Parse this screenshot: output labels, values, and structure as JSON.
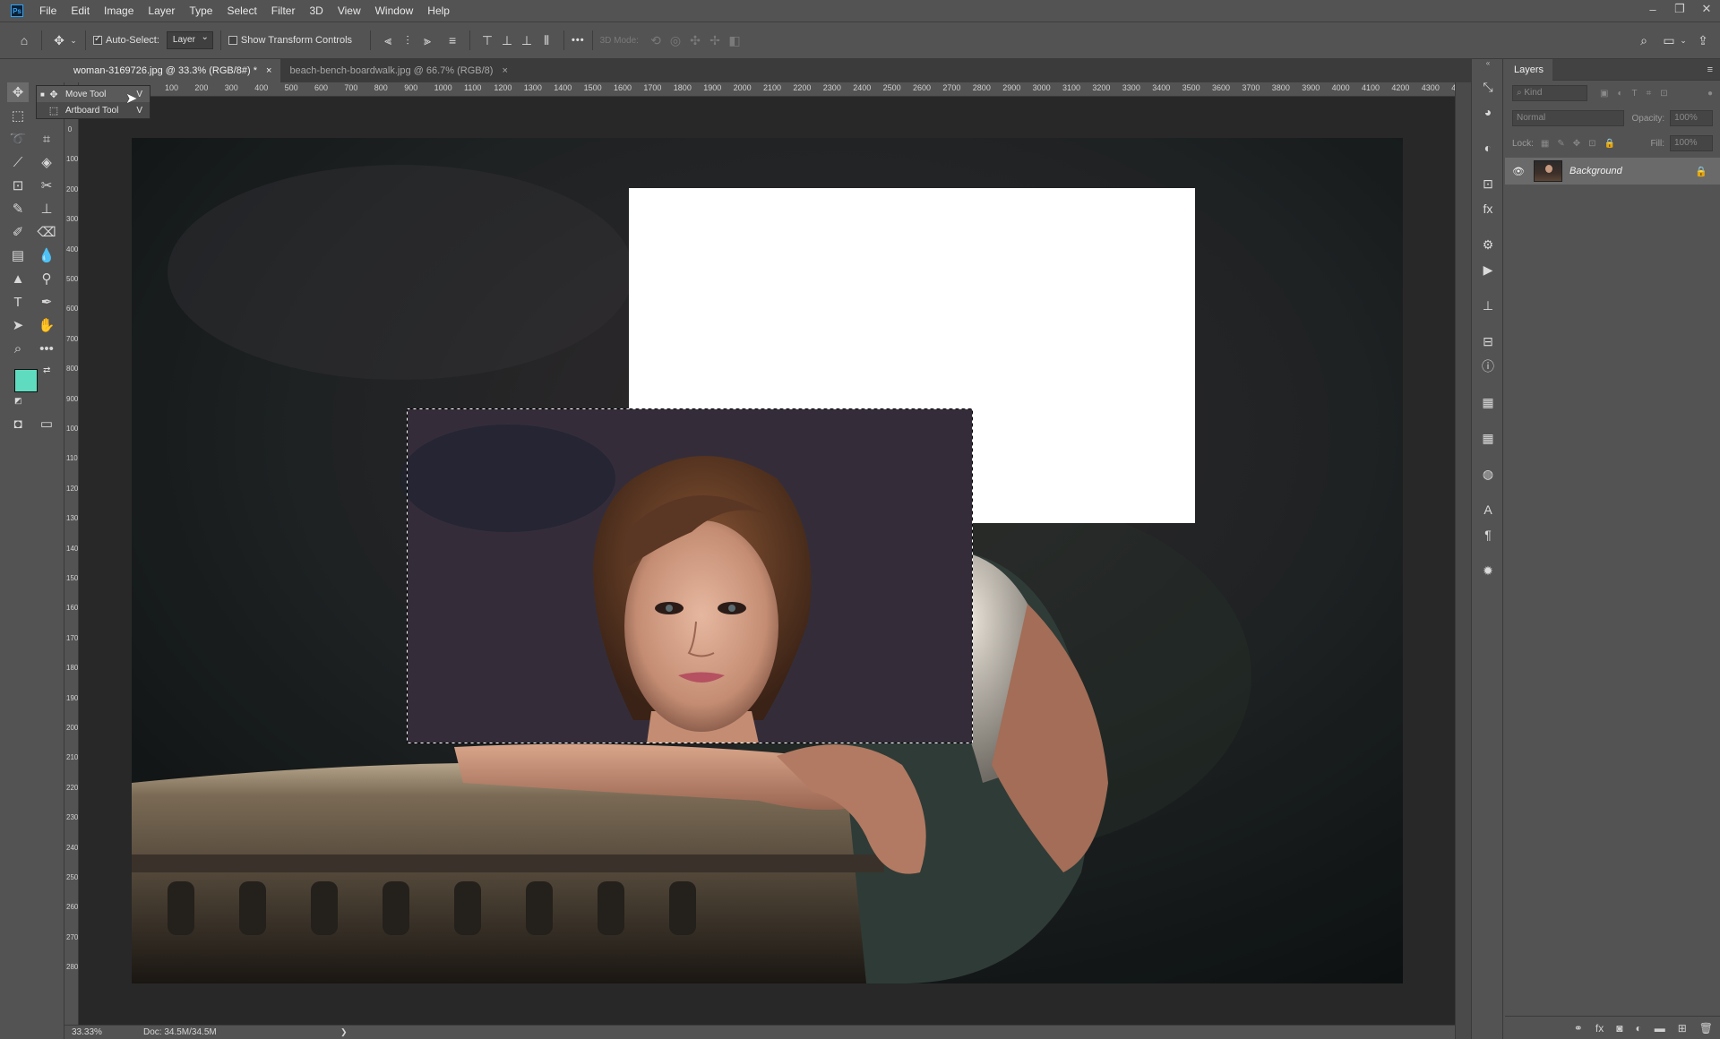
{
  "menu": {
    "logo": "Ps",
    "items": [
      "File",
      "Edit",
      "Image",
      "Layer",
      "Type",
      "Select",
      "Filter",
      "3D",
      "View",
      "Window",
      "Help"
    ]
  },
  "options_bar": {
    "auto_select_label": "Auto-Select:",
    "auto_select_checked": true,
    "auto_select_target": "Layer",
    "show_transform_label": "Show Transform Controls",
    "show_transform_checked": false,
    "mode_3d_label": "3D Mode:",
    "more_label": "•••"
  },
  "tabs": [
    {
      "label": "woman-3169726.jpg @ 33.3% (RGB/8#) *",
      "active": true,
      "close": "×"
    },
    {
      "label": "beach-bench-boardwalk.jpg @ 66.7% (RGB/8)",
      "active": false,
      "close": "×"
    }
  ],
  "flyout": {
    "items": [
      {
        "label": "Move Tool",
        "key": "V",
        "icon": "move-icon",
        "selected": true,
        "bullet": "■"
      },
      {
        "label": "Artboard Tool",
        "key": "V",
        "icon": "artboard-icon",
        "selected": false,
        "bullet": ""
      }
    ]
  },
  "ruler": {
    "h_ticks": [
      "100",
      "200",
      "300",
      "400",
      "500",
      "600",
      "700",
      "800",
      "900",
      "1000",
      "1100",
      "1200",
      "1300",
      "1400",
      "1500",
      "1600",
      "1700",
      "1800",
      "1900",
      "2000",
      "2100",
      "2200",
      "2300",
      "2400",
      "2500",
      "2600",
      "2700",
      "2800",
      "2900",
      "3000",
      "3100",
      "3200",
      "3300",
      "3400",
      "3500",
      "3600",
      "3700",
      "3800",
      "3900",
      "4000",
      "4100",
      "4200",
      "4300",
      "4"
    ],
    "v_ticks": [
      "0",
      "100",
      "200",
      "300",
      "400",
      "500",
      "600",
      "700",
      "800",
      "900",
      "1000",
      "1100",
      "1200",
      "1300",
      "1400",
      "1500",
      "1600",
      "1700",
      "1800",
      "1900",
      "2000",
      "2100",
      "2200",
      "2300",
      "2400",
      "2500",
      "2600",
      "2700",
      "2800"
    ]
  },
  "colors": {
    "foreground": "#5fdcbf",
    "background": "#ffffff",
    "selection_marquee": "#ffffff"
  },
  "status": {
    "zoom": "33.33%",
    "doc": "Doc: 34.5M/34.5M",
    "arrow": "❯"
  },
  "layers_panel": {
    "title": "Layers",
    "filter_label": "Kind",
    "blend_mode": "Normal",
    "opacity_label": "Opacity:",
    "opacity_value": "100%",
    "lock_label": "Lock:",
    "fill_label": "Fill:",
    "fill_value": "100%",
    "layers": [
      {
        "name": "Background",
        "visible": true,
        "locked": true
      }
    ]
  }
}
